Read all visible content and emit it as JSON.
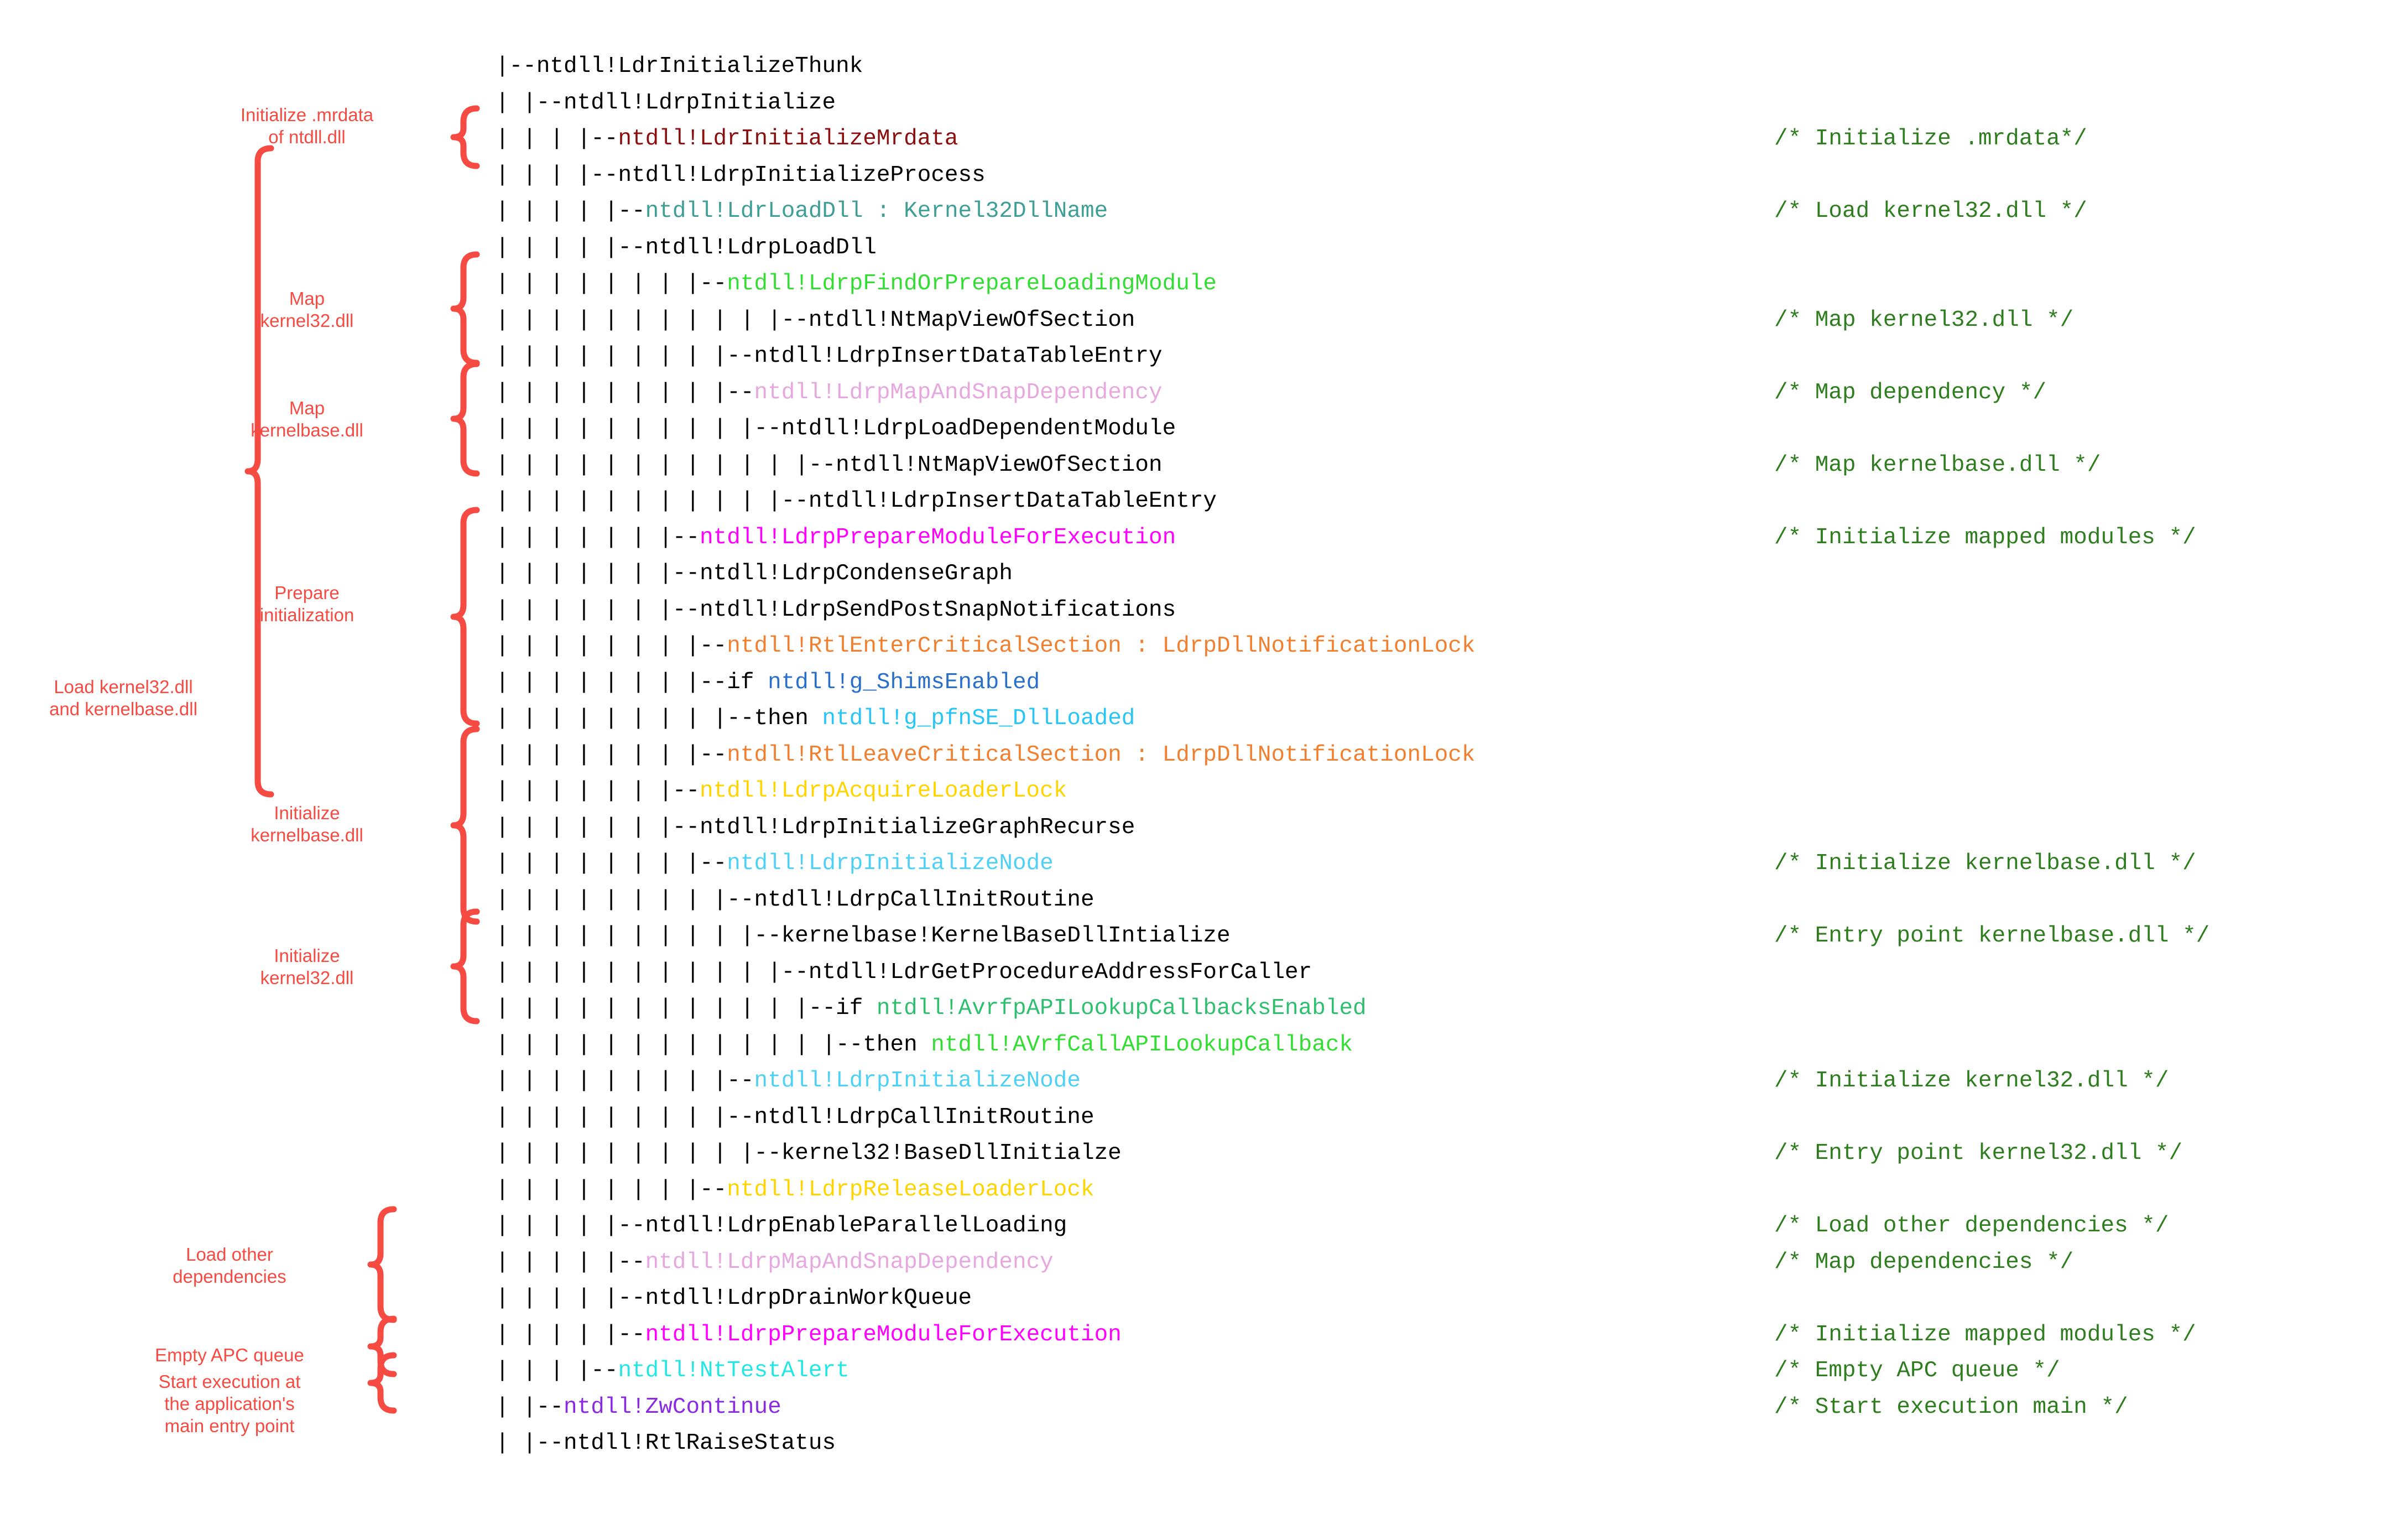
{
  "colors": {
    "default_text": "#000000",
    "comment_green": "#2e7d1e",
    "annotation_red": "#f54b42",
    "dark_red": "#8b0f0f",
    "teal": "#3f9e96",
    "bright_green": "#33dd33",
    "pink": "#e6a8de",
    "magenta": "#ff00ff",
    "orange": "#f08030",
    "blue": "#2a6fc9",
    "cyan": "#29c5f6",
    "yellow": "#ffd400",
    "cyan_bright": "#25e5e5",
    "purple": "#8a2be2",
    "sea_green": "#2fbf6f",
    "sky": "#4fd0f5"
  },
  "tree": {
    "lines": [
      {
        "indent": "|--",
        "segments": [
          {
            "text": "ntdll!LdrInitializeThunk",
            "color": "default_text"
          }
        ]
      },
      {
        "indent": "| |--",
        "segments": [
          {
            "text": "ntdll!LdrpInitialize",
            "color": "default_text"
          }
        ]
      },
      {
        "indent": "| | | |--",
        "segments": [
          {
            "text": "ntdll!LdrInitializeMrdata",
            "color": "dark_red"
          }
        ]
      },
      {
        "indent": "| | | |--",
        "segments": [
          {
            "text": "ntdll!LdrpInitializeProcess",
            "color": "default_text"
          }
        ]
      },
      {
        "indent": "| | | | |--",
        "segments": [
          {
            "text": "ntdll!LdrLoadDll : Kernel32DllName",
            "color": "teal"
          }
        ]
      },
      {
        "indent": "| | | | |--",
        "segments": [
          {
            "text": "ntdll!LdrpLoadDll",
            "color": "default_text"
          }
        ]
      },
      {
        "indent": "| | | | | | | |--",
        "segments": [
          {
            "text": "ntdll!LdrpFindOrPrepareLoadingModule",
            "color": "bright_green"
          }
        ]
      },
      {
        "indent": "| | | | | | | | | | |--",
        "segments": [
          {
            "text": "ntdll!NtMapViewOfSection",
            "color": "default_text"
          }
        ]
      },
      {
        "indent": "| | | | | | | | |--",
        "segments": [
          {
            "text": "ntdll!LdrpInsertDataTableEntry",
            "color": "default_text"
          }
        ]
      },
      {
        "indent": "| | | | | | | | |--",
        "segments": [
          {
            "text": "ntdll!LdrpMapAndSnapDependency",
            "color": "pink"
          }
        ]
      },
      {
        "indent": "| | | | | | | | | |--",
        "segments": [
          {
            "text": "ntdll!LdrpLoadDependentModule",
            "color": "default_text"
          }
        ]
      },
      {
        "indent": "| | | | | | | | | | | |--",
        "segments": [
          {
            "text": "ntdll!NtMapViewOfSection",
            "color": "default_text"
          }
        ]
      },
      {
        "indent": "| | | | | | | | | | |--",
        "segments": [
          {
            "text": "ntdll!LdrpInsertDataTableEntry",
            "color": "default_text"
          }
        ]
      },
      {
        "indent": "| | | | | | |--",
        "segments": [
          {
            "text": "ntdll!LdrpPrepareModuleForExecution",
            "color": "magenta"
          }
        ]
      },
      {
        "indent": "| | | | | | |--",
        "segments": [
          {
            "text": "ntdll!LdrpCondenseGraph",
            "color": "default_text"
          }
        ]
      },
      {
        "indent": "| | | | | | |--",
        "segments": [
          {
            "text": "ntdll!LdrpSendPostSnapNotifications",
            "color": "default_text"
          }
        ]
      },
      {
        "indent": "| | | | | | | |--",
        "segments": [
          {
            "text": "ntdll!RtlEnterCriticalSection : LdrpDllNotificationLock",
            "color": "orange"
          }
        ]
      },
      {
        "indent": "| | | | | | | |--",
        "segments": [
          {
            "text": "if ",
            "color": "default_text"
          },
          {
            "text": "ntdll!g_ShimsEnabled",
            "color": "blue"
          }
        ]
      },
      {
        "indent": "| | | | | | | | |--",
        "segments": [
          {
            "text": "then ",
            "color": "default_text"
          },
          {
            "text": "ntdll!g_pfnSE_DllLoaded",
            "color": "cyan"
          }
        ]
      },
      {
        "indent": "| | | | | | | |--",
        "segments": [
          {
            "text": "ntdll!RtlLeaveCriticalSection : LdrpDllNotificationLock",
            "color": "orange"
          }
        ]
      },
      {
        "indent": "| | | | | | |--",
        "segments": [
          {
            "text": "ntdll!LdrpAcquireLoaderLock",
            "color": "yellow"
          }
        ]
      },
      {
        "indent": "| | | | | | |--",
        "segments": [
          {
            "text": "ntdll!LdrpInitializeGraphRecurse",
            "color": "default_text"
          }
        ]
      },
      {
        "indent": "| | | | | | | |--",
        "segments": [
          {
            "text": "ntdll!LdrpInitializeNode",
            "color": "sky"
          }
        ]
      },
      {
        "indent": "| | | | | | | | |--",
        "segments": [
          {
            "text": "ntdll!LdrpCallInitRoutine",
            "color": "default_text"
          }
        ]
      },
      {
        "indent": "| | | | | | | | | |--",
        "segments": [
          {
            "text": "kernelbase!KernelBaseDllIntialize",
            "color": "default_text"
          }
        ]
      },
      {
        "indent": "| | | | | | | | | | |--",
        "segments": [
          {
            "text": "ntdll!LdrGetProcedureAddressForCaller",
            "color": "default_text"
          }
        ]
      },
      {
        "indent": "| | | | | | | | | | | |--",
        "segments": [
          {
            "text": "if ",
            "color": "default_text"
          },
          {
            "text": "ntdll!AvrfpAPILookupCallbacksEnabled",
            "color": "sea_green"
          }
        ]
      },
      {
        "indent": "| | | | | | | | | | | | |--",
        "segments": [
          {
            "text": "then ",
            "color": "default_text"
          },
          {
            "text": "ntdll!AVrfCallAPILookupCallback",
            "color": "bright_green"
          }
        ]
      },
      {
        "indent": "| | | | | | | | |--",
        "segments": [
          {
            "text": "ntdll!LdrpInitializeNode",
            "color": "sky"
          }
        ]
      },
      {
        "indent": "| | | | | | | | |--",
        "segments": [
          {
            "text": "ntdll!LdrpCallInitRoutine",
            "color": "default_text"
          }
        ]
      },
      {
        "indent": "| | | | | | | | | |--",
        "segments": [
          {
            "text": "kernel32!BaseDllInitialze",
            "color": "default_text"
          }
        ]
      },
      {
        "indent": "| | | | | | | |--",
        "segments": [
          {
            "text": "ntdll!LdrpReleaseLoaderLock",
            "color": "yellow"
          }
        ]
      },
      {
        "indent": "| | | | |--",
        "segments": [
          {
            "text": "ntdll!LdrpEnableParallelLoading",
            "color": "default_text"
          }
        ]
      },
      {
        "indent": "| | | | |--",
        "segments": [
          {
            "text": "ntdll!LdrpMapAndSnapDependency",
            "color": "pink"
          }
        ]
      },
      {
        "indent": "| | | | |--",
        "segments": [
          {
            "text": "ntdll!LdrpDrainWorkQueue",
            "color": "default_text"
          }
        ]
      },
      {
        "indent": "| | | | |--",
        "segments": [
          {
            "text": "ntdll!LdrpPrepareModuleForExecution",
            "color": "magenta"
          }
        ]
      },
      {
        "indent": "| | | |--",
        "segments": [
          {
            "text": "ntdll!NtTestAlert",
            "color": "cyan_bright"
          }
        ]
      },
      {
        "indent": "| |--",
        "segments": [
          {
            "text": "ntdll!ZwContinue",
            "color": "purple"
          }
        ]
      },
      {
        "indent": "| |--",
        "segments": [
          {
            "text": "ntdll!RtlRaiseStatus",
            "color": "default_text"
          }
        ]
      }
    ]
  },
  "comments": [
    {
      "line": 2,
      "text": "/* Initialize .mrdata*/"
    },
    {
      "line": 4,
      "text": "/* Load kernel32.dll */"
    },
    {
      "line": 7,
      "text": "/* Map kernel32.dll */"
    },
    {
      "line": 9,
      "text": "/* Map dependency */"
    },
    {
      "line": 11,
      "text": "/* Map kernelbase.dll */"
    },
    {
      "line": 13,
      "text": "/* Initialize mapped modules */"
    },
    {
      "line": 22,
      "text": "/* Initialize kernelbase.dll */"
    },
    {
      "line": 24,
      "text": "/* Entry point kernelbase.dll */"
    },
    {
      "line": 28,
      "text": "/* Initialize kernel32.dll */"
    },
    {
      "line": 30,
      "text": "/* Entry point kernel32.dll */"
    },
    {
      "line": 32,
      "text": "/* Load other dependencies */"
    },
    {
      "line": 33,
      "text": "/* Map dependencies */"
    },
    {
      "line": 35,
      "text": "/* Initialize mapped modules */"
    },
    {
      "line": 36,
      "text": "/* Empty APC queue */"
    },
    {
      "line": 37,
      "text": "/* Start execution main */"
    }
  ],
  "annotations": [
    {
      "id": "init-mrdata",
      "text": "Initialize .mrdata\nof ntdll.dll"
    },
    {
      "id": "map-kernel32",
      "text": "Map\nkernel32.dll"
    },
    {
      "id": "map-kernelbase",
      "text": "Map\nkernelbase.dll"
    },
    {
      "id": "prepare-init",
      "text": "Prepare\ninitialization"
    },
    {
      "id": "init-kernelbase",
      "text": "Initialize\nkernelbase.dll"
    },
    {
      "id": "init-kernel32",
      "text": "Initialize\nkernel32.dll"
    },
    {
      "id": "load-other-deps",
      "text": "Load other\ndependencies"
    },
    {
      "id": "empty-apc-queue",
      "text": "Empty APC queue"
    },
    {
      "id": "start-execution",
      "text": "Start execution at\nthe application's\nmain entry point"
    },
    {
      "id": "load-kernel32-base",
      "text": "Load kernel32.dll\nand kernelbase.dll"
    }
  ]
}
